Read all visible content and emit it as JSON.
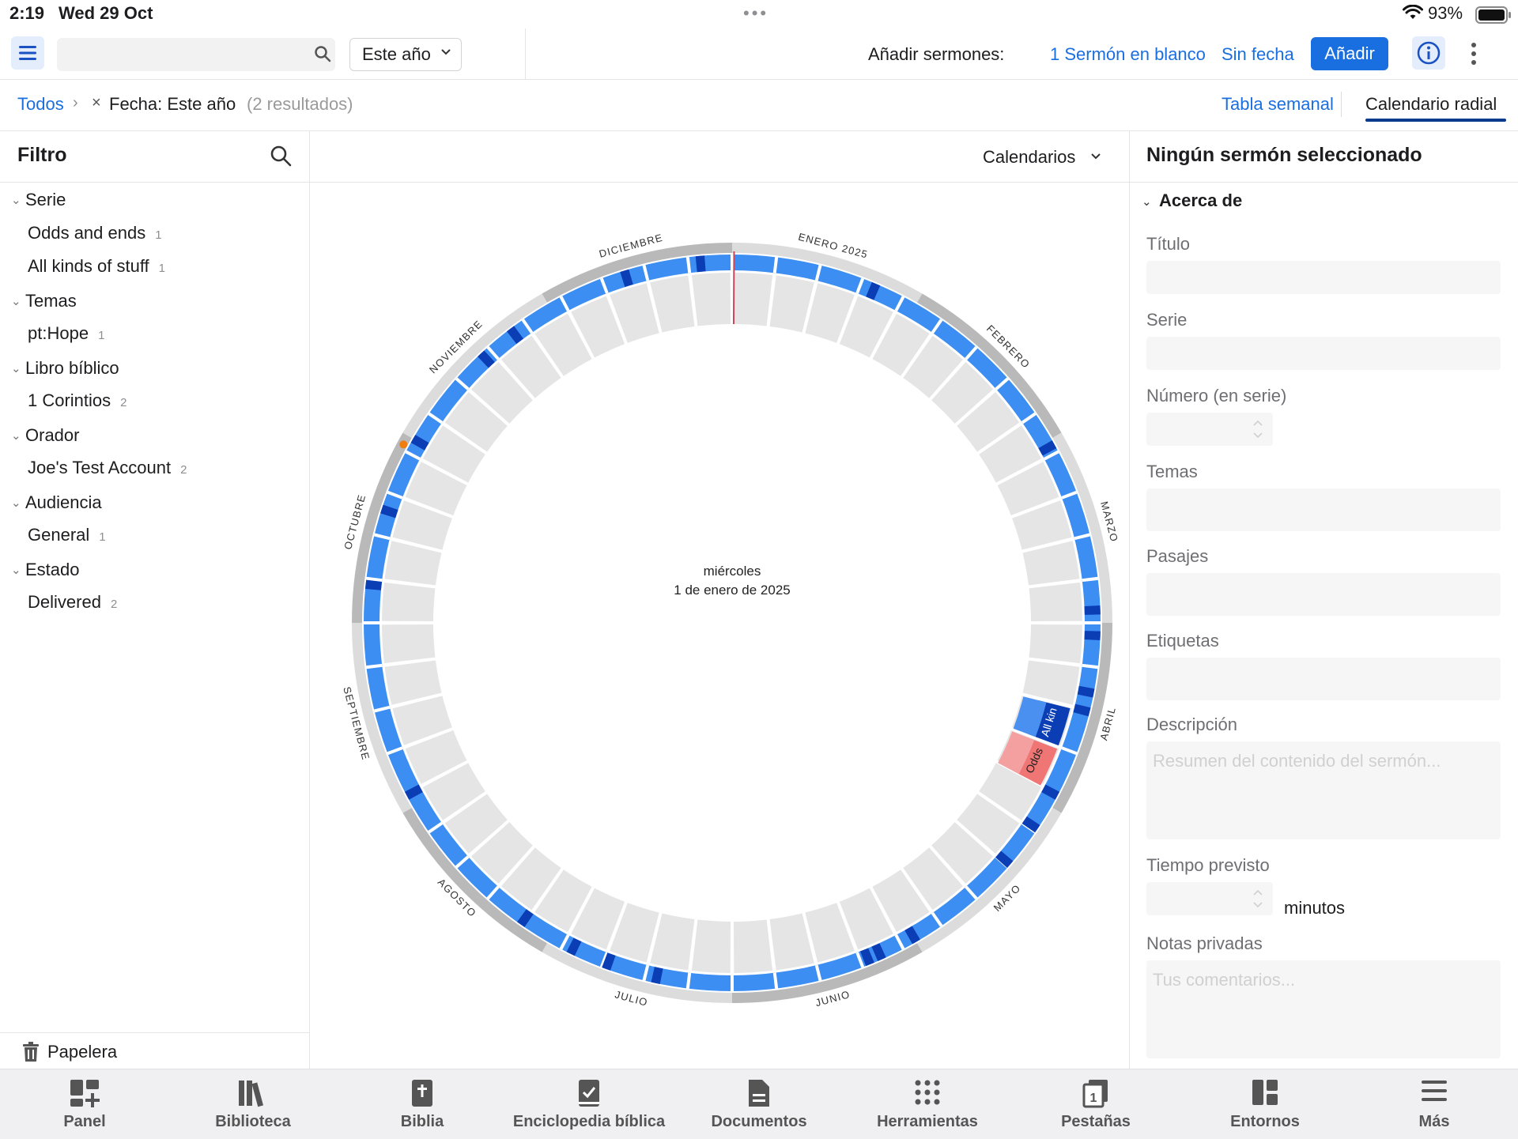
{
  "status_bar": {
    "time": "2:19",
    "date": "Wed 29 Oct",
    "battery": "93%"
  },
  "toolbar": {
    "search_placeholder": "",
    "period_label": "Este año",
    "add_label": "Añadir sermones:",
    "blank_sermon": "1 Sermón en blanco",
    "undated": "Sin fecha",
    "add_button": "Añadir"
  },
  "breadcrumb": {
    "root": "Todos",
    "filter": "Fecha: Este año",
    "count": "(2 resultados)",
    "tab_weekly": "Tabla semanal",
    "tab_radial": "Calendario radial"
  },
  "filter": {
    "title": "Filtro",
    "sections": [
      {
        "label": "Serie",
        "items": [
          {
            "label": "Odds and ends",
            "count": "1"
          },
          {
            "label": "All kinds of stuff",
            "count": "1"
          }
        ]
      },
      {
        "label": "Temas",
        "items": [
          {
            "label": "pt:Hope",
            "count": "1"
          }
        ]
      },
      {
        "label": "Libro bíblico",
        "items": [
          {
            "label": "1 Corintios",
            "count": "2"
          }
        ]
      },
      {
        "label": "Orador",
        "items": [
          {
            "label": "Joe's Test Account",
            "count": "2"
          }
        ]
      },
      {
        "label": "Audiencia",
        "items": [
          {
            "label": "General",
            "count": "1"
          }
        ]
      },
      {
        "label": "Estado",
        "items": [
          {
            "label": "Delivered",
            "count": "2"
          }
        ]
      }
    ],
    "trash": "Papelera"
  },
  "calendar": {
    "calendars_label": "Calendarios",
    "center_day": "miércoles",
    "center_date": "1 de enero de 2025",
    "months": [
      "ENERO 2025",
      "FEBRERO",
      "MARZO",
      "ABRIL",
      "MAYO",
      "JUNIO",
      "JULIO",
      "AGOSTO",
      "SEPTIEMBRE",
      "OCTUBRE",
      "NOVIEMBRE",
      "DICIEMBRE"
    ],
    "events": [
      {
        "label": "All kin"
      },
      {
        "label": "Odds"
      }
    ],
    "colors": {
      "ring": "#3d8ef2",
      "ring_mark": "#0b3db5",
      "week_cell": "#e5e5e5",
      "outer_ring": "#dcdcdc",
      "outer_ring_alt": "#b9b9b9",
      "event_blue": "#0b3db5",
      "event_red": "#f07575",
      "today_line": "#c9475a",
      "marker": "#f07d0f"
    }
  },
  "detail": {
    "title": "Ningún sermón seleccionado",
    "section": "Acerca de",
    "fields": {
      "titulo": "Título",
      "serie": "Serie",
      "numero": "Número (en serie)",
      "temas": "Temas",
      "pasajes": "Pasajes",
      "etiquetas": "Etiquetas",
      "descripcion": "Descripción",
      "descripcion_placeholder": "Resumen del contenido del sermón...",
      "tiempo": "Tiempo previsto",
      "minutos": "minutos",
      "notas": "Notas privadas",
      "notas_placeholder": "Tus comentarios..."
    }
  },
  "tabbar": [
    {
      "label": "Panel",
      "icon": "panel-icon"
    },
    {
      "label": "Biblioteca",
      "icon": "library-icon"
    },
    {
      "label": "Biblia",
      "icon": "bible-icon"
    },
    {
      "label": "Enciclopedia bíblica",
      "icon": "encyclopedia-icon"
    },
    {
      "label": "Documentos",
      "icon": "documents-icon"
    },
    {
      "label": "Herramientas",
      "icon": "tools-icon"
    },
    {
      "label": "Pestañas",
      "icon": "tabs-icon"
    },
    {
      "label": "Entornos",
      "icon": "layouts-icon"
    },
    {
      "label": "Más",
      "icon": "more-icon"
    }
  ]
}
